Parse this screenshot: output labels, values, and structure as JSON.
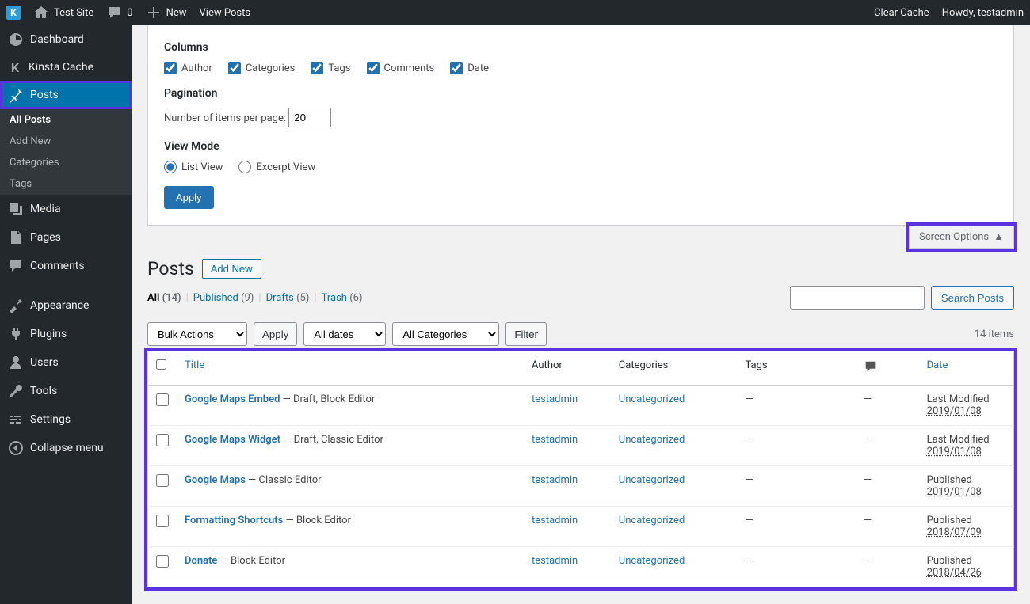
{
  "adminBar": {
    "siteName": "Test Site",
    "commentCount": "0",
    "newLabel": "New",
    "viewPosts": "View Posts",
    "clearCache": "Clear Cache",
    "howdy": "Howdy, testadmin"
  },
  "sidebar": {
    "dashboard": "Dashboard",
    "kinstaCache": "Kinsta Cache",
    "posts": "Posts",
    "allPosts": "All Posts",
    "addNew": "Add New",
    "categories": "Categories",
    "tags": "Tags",
    "media": "Media",
    "pages": "Pages",
    "comments": "Comments",
    "appearance": "Appearance",
    "plugins": "Plugins",
    "users": "Users",
    "tools": "Tools",
    "settings": "Settings",
    "collapse": "Collapse menu"
  },
  "screenOptions": {
    "columnsHeading": "Columns",
    "authorLabel": "Author",
    "categoriesLabel": "Categories",
    "tagsLabel": "Tags",
    "commentsLabel": "Comments",
    "dateLabel": "Date",
    "paginationHeading": "Pagination",
    "perPageLabel": "Number of items per page:",
    "perPageValue": "20",
    "viewModeHeading": "View Mode",
    "listView": "List View",
    "excerptView": "Excerpt View",
    "applyLabel": "Apply",
    "tabLabel": "Screen Options"
  },
  "page": {
    "title": "Posts",
    "addNew": "Add New"
  },
  "filters": {
    "allLabel": "All",
    "allCount": "(14)",
    "publishedLabel": "Published",
    "publishedCount": "(9)",
    "draftsLabel": "Drafts",
    "draftsCount": "(5)",
    "trashLabel": "Trash",
    "trashCount": "(6)",
    "searchButton": "Search Posts"
  },
  "tablenav": {
    "bulkActions": "Bulk Actions",
    "apply": "Apply",
    "allDates": "All dates",
    "allCategories": "All Categories",
    "filter": "Filter",
    "itemCount": "14 items"
  },
  "table": {
    "headers": {
      "title": "Title",
      "author": "Author",
      "categories": "Categories",
      "tags": "Tags",
      "date": "Date"
    },
    "rows": [
      {
        "title": "Google Maps Embed",
        "state": " — Draft, Block Editor",
        "author": "testadmin",
        "category": "Uncategorized",
        "tags": "—",
        "comments": "—",
        "dateStatus": "Last Modified",
        "dateVal": "2019/01/08"
      },
      {
        "title": "Google Maps Widget",
        "state": " — Draft, Classic Editor",
        "author": "testadmin",
        "category": "Uncategorized",
        "tags": "—",
        "comments": "—",
        "dateStatus": "Last Modified",
        "dateVal": "2019/01/08"
      },
      {
        "title": "Google Maps",
        "state": " — Classic Editor",
        "author": "testadmin",
        "category": "Uncategorized",
        "tags": "—",
        "comments": "—",
        "dateStatus": "Published",
        "dateVal": "2019/01/08"
      },
      {
        "title": "Formatting Shortcuts",
        "state": " — Block Editor",
        "author": "testadmin",
        "category": "Uncategorized",
        "tags": "—",
        "comments": "—",
        "dateStatus": "Published",
        "dateVal": "2018/07/09"
      },
      {
        "title": "Donate",
        "state": " — Block Editor",
        "author": "testadmin",
        "category": "Uncategorized",
        "tags": "—",
        "comments": "—",
        "dateStatus": "Published",
        "dateVal": "2018/04/26"
      }
    ]
  }
}
